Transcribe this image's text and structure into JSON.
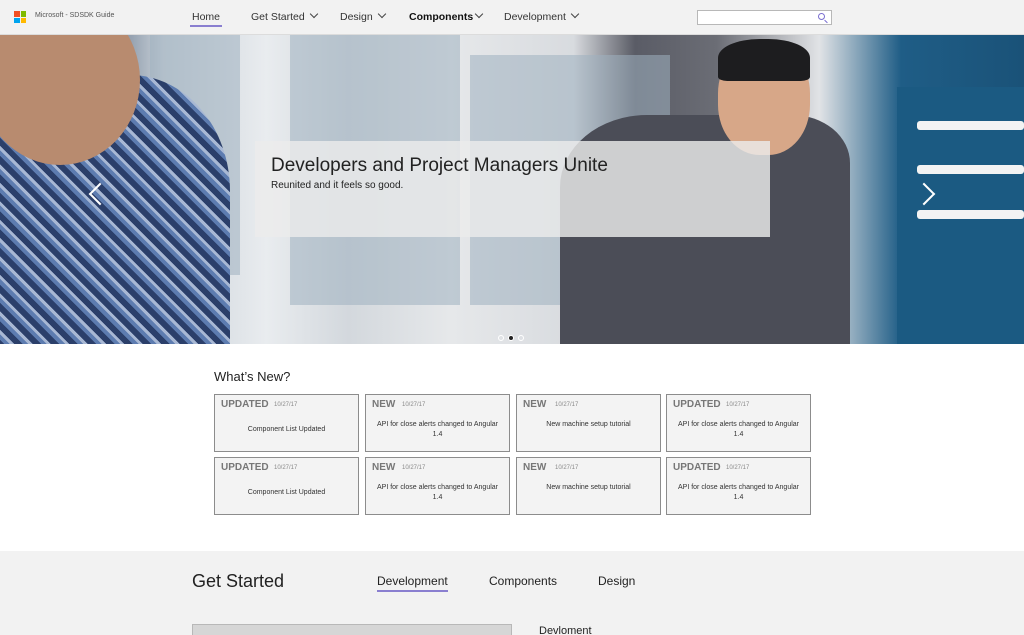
{
  "header": {
    "brand": "Microsoft - SDSDK Guide",
    "nav": [
      {
        "label": "Home"
      },
      {
        "label": "Get Started"
      },
      {
        "label": "Design"
      },
      {
        "label": "Components"
      },
      {
        "label": "Development"
      }
    ],
    "search_placeholder": ""
  },
  "hero": {
    "title": "Developers and Project Managers Unite",
    "subtitle": "Reunited and it feels so good.",
    "slides": 3,
    "active_slide": 2
  },
  "whats_new": {
    "title": "What’s New?",
    "cards": [
      {
        "tag": "UPDATED",
        "date": "10/27/17",
        "desc": "Component List Updated"
      },
      {
        "tag": "NEW",
        "date": "10/27/17",
        "desc": "API for close alerts changed to Angular 1.4"
      },
      {
        "tag": "NEW",
        "date": "10/27/17",
        "desc": "New machine setup tutorial"
      },
      {
        "tag": "UPDATED",
        "date": "10/27/17",
        "desc": "API for close alerts changed to Angular 1.4"
      },
      {
        "tag": "UPDATED",
        "date": "10/27/17",
        "desc": "Component List Updated"
      },
      {
        "tag": "NEW",
        "date": "10/27/17",
        "desc": "API for close alerts changed to Angular 1.4"
      },
      {
        "tag": "NEW",
        "date": "10/27/17",
        "desc": "New machine setup tutorial"
      },
      {
        "tag": "UPDATED",
        "date": "10/27/17",
        "desc": "API for close alerts changed to Angular 1.4"
      }
    ]
  },
  "get_started": {
    "title": "Get Started",
    "tabs": [
      {
        "label": "Development"
      },
      {
        "label": "Components"
      },
      {
        "label": "Design"
      }
    ],
    "panel_heading": "Devloment"
  },
  "colors": {
    "accent": "#8a7fd0",
    "nav_bg": "#f2f2f2"
  }
}
